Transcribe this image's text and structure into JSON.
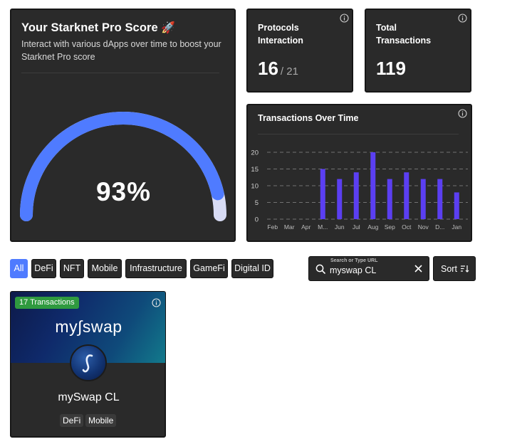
{
  "score_card": {
    "title": "Your Starknet Pro Score",
    "emoji": "🚀",
    "subtitle": "Interact with various dApps over time to boost your Starknet Pro score",
    "score_percent": 93,
    "score_label": "93%",
    "colors": {
      "gauge_fill": "#4f7bff",
      "gauge_track": "#d8dcf5"
    }
  },
  "protocols_card": {
    "label": "Protocols Interaction",
    "value": "16",
    "total": "/ 21"
  },
  "transactions_card": {
    "label": "Total Transactions",
    "value": "119"
  },
  "chart_card": {
    "label": "Transactions Over Time"
  },
  "chart_data": {
    "type": "bar",
    "categories": [
      "Feb",
      "Mar",
      "Apr",
      "M...",
      "Jun",
      "Jul",
      "Aug",
      "Sep",
      "Oct",
      "Nov",
      "D...",
      "Jan"
    ],
    "values": [
      0,
      0,
      0,
      15,
      12,
      14,
      20,
      12,
      14,
      12,
      12,
      8
    ],
    "yticks": [
      "20",
      "15",
      "10",
      "5",
      "0"
    ],
    "ylim": [
      0,
      20
    ],
    "grid": true,
    "bar_color": "#5b3ff2"
  },
  "filters": {
    "items": [
      {
        "label": "All",
        "active": true
      },
      {
        "label": "DeFi",
        "active": false
      },
      {
        "label": "NFT",
        "active": false
      },
      {
        "label": "Mobile",
        "active": false
      },
      {
        "label": "Infrastructure",
        "active": false
      },
      {
        "label": "GameFi",
        "active": false
      },
      {
        "label": "Digital ID",
        "active": false
      }
    ]
  },
  "search": {
    "label": "Search or Type URL",
    "value": "myswap CL"
  },
  "sort": {
    "label": "Sort"
  },
  "dapp": {
    "tx_badge": "17 Transactions",
    "brand": "my∫swap",
    "name": "mySwap CL",
    "tags": [
      "DeFi",
      "Mobile"
    ],
    "colors": {
      "badge": "#2f9a3f"
    }
  }
}
